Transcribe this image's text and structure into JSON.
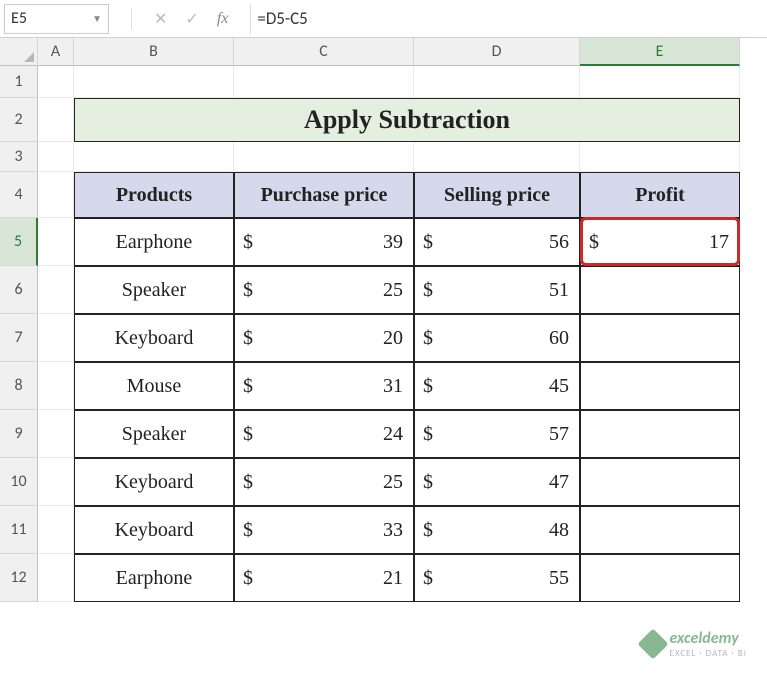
{
  "nameBox": "E5",
  "formula": "=D5-C5",
  "colHeaders": [
    "A",
    "B",
    "C",
    "D",
    "E"
  ],
  "rowHeaders": [
    "1",
    "2",
    "3",
    "4",
    "5",
    "6",
    "7",
    "8",
    "9",
    "10",
    "11",
    "12"
  ],
  "title": "Apply Subtraction",
  "headers": {
    "products": "Products",
    "purchase": "Purchase price",
    "selling": "Selling price",
    "profit": "Profit"
  },
  "currency": "$",
  "rows": [
    {
      "product": "Earphone",
      "purchase": "39",
      "selling": "56",
      "profit": "17"
    },
    {
      "product": "Speaker",
      "purchase": "25",
      "selling": "51",
      "profit": ""
    },
    {
      "product": "Keyboard",
      "purchase": "20",
      "selling": "60",
      "profit": ""
    },
    {
      "product": "Mouse",
      "purchase": "31",
      "selling": "45",
      "profit": ""
    },
    {
      "product": "Speaker",
      "purchase": "24",
      "selling": "57",
      "profit": ""
    },
    {
      "product": "Keyboard",
      "purchase": "25",
      "selling": "47",
      "profit": ""
    },
    {
      "product": "Keyboard",
      "purchase": "33",
      "selling": "48",
      "profit": ""
    },
    {
      "product": "Earphone",
      "purchase": "21",
      "selling": "55",
      "profit": ""
    }
  ],
  "selectedCell": "E5",
  "watermark": {
    "brand": "exceldemy",
    "tag": "EXCEL · DATA · BI"
  },
  "chart_data": {
    "type": "table",
    "title": "Apply Subtraction",
    "columns": [
      "Products",
      "Purchase price",
      "Selling price",
      "Profit"
    ],
    "data": [
      [
        "Earphone",
        39,
        56,
        17
      ],
      [
        "Speaker",
        25,
        51,
        null
      ],
      [
        "Keyboard",
        20,
        60,
        null
      ],
      [
        "Mouse",
        31,
        45,
        null
      ],
      [
        "Speaker",
        24,
        57,
        null
      ],
      [
        "Keyboard",
        25,
        47,
        null
      ],
      [
        "Keyboard",
        33,
        48,
        null
      ],
      [
        "Earphone",
        21,
        55,
        null
      ]
    ]
  }
}
